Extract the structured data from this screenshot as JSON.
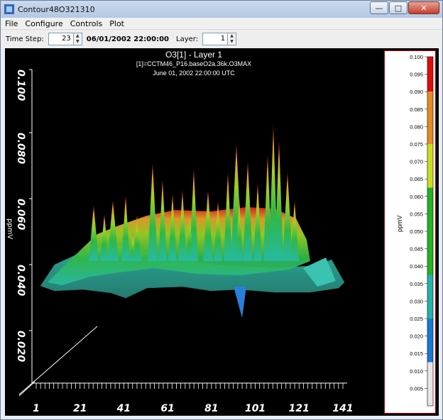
{
  "window": {
    "title": "Contour48O321310",
    "controls": {
      "minimize": "—",
      "maximize": "□",
      "close": "✕"
    }
  },
  "menu": [
    "File",
    "Configure",
    "Controls",
    "Plot"
  ],
  "toolbar": {
    "time_step_label": "Time Step:",
    "time_step_value": "23",
    "date_text": "06/01/2002 22:00:00",
    "layer_label": "Layer:",
    "layer_value": "1"
  },
  "plot": {
    "title": "O3[1] - Layer 1",
    "subtitle": "[1]=CCTM46_P16.baseO2a.36k.O3MAX",
    "date": "June 01, 2002 22:00:00 UTC",
    "y_axis_label": "ppmV",
    "y_ticks": [
      "0.020",
      "0.040",
      "0.060",
      "0.080",
      "0.100"
    ],
    "x_ticks": [
      "1",
      "21",
      "41",
      "61",
      "81",
      "101",
      "121",
      "141"
    ]
  },
  "legend": {
    "unit": "ppmV",
    "labels": [
      "0.100",
      "0.095",
      "0.090",
      "0.085",
      "0.080",
      "0.075",
      "0.070",
      "0.065",
      "0.060",
      "0.055",
      "0.050",
      "0.045",
      "0.040",
      "0.035",
      "0.030",
      "0.025",
      "0.020",
      "0.015",
      "0.010",
      "0.005"
    ],
    "colors": [
      "#e10d0d",
      "#e78a22",
      "#c8e01c",
      "#22b422",
      "#22b4aa",
      "#1a78d6",
      "#e6e6e6"
    ],
    "bounds": [
      0.1,
      0.09,
      0.075,
      0.0625,
      0.0375,
      0.025,
      0.0125,
      0.0
    ]
  },
  "colors": {
    "background": "#000000",
    "axis": "#ffffff",
    "legend_border": "#c00000"
  }
}
